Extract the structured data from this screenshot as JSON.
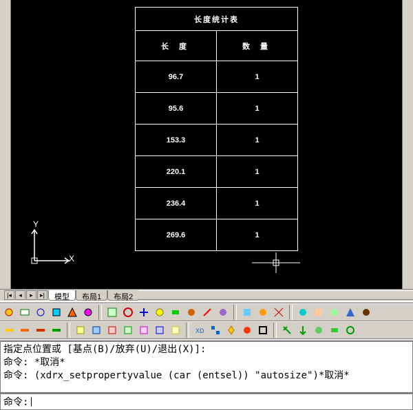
{
  "table": {
    "title": "长度统计表",
    "header_a": "长 度",
    "header_b": "数 量",
    "rows": [
      {
        "a": "96.7",
        "b": "1"
      },
      {
        "a": "95.6",
        "b": "1"
      },
      {
        "a": "153.3",
        "b": "1"
      },
      {
        "a": "220.1",
        "b": "1"
      },
      {
        "a": "236.4",
        "b": "1"
      },
      {
        "a": "269.6",
        "b": "1"
      }
    ]
  },
  "ucs": {
    "x": "X",
    "y": "Y"
  },
  "tabs": {
    "model": "模型",
    "layout1": "布局1",
    "layout2": "布局2"
  },
  "command": {
    "line1": "指定点位置或 [基点(B)/放弃(U)/退出(X)]:",
    "line2_prefix": "命令:",
    "line2_body": " *取消*",
    "line3_prefix": "命令:",
    "line3_body": " (xdrx_setpropertyvalue (car (entsel)) \"autosize\")*取消*",
    "input_prefix": "命令:"
  },
  "icons": {
    "row1": [
      "tool",
      "tool",
      "tool",
      "tool",
      "tool",
      "tool",
      "tool",
      "tool",
      "tool",
      "tool",
      "tool",
      "tool",
      "tool",
      "tool",
      "tool",
      "tool",
      "tool",
      "tool",
      "tool",
      "tool",
      "tool",
      "tool",
      "tool",
      "tool"
    ],
    "row2": [
      "tool",
      "tool",
      "tool",
      "tool",
      "tool",
      "tool",
      "tool",
      "tool",
      "tool",
      "tool",
      "tool",
      "tool",
      "tool",
      "tool",
      "tool",
      "tool",
      "tool",
      "tool",
      "tool",
      "tool",
      "tool",
      "tool",
      "tool",
      "tool"
    ]
  },
  "colors": {
    "bg": "#000000",
    "fg": "#ffffff",
    "ui": "#d4d0c8"
  }
}
